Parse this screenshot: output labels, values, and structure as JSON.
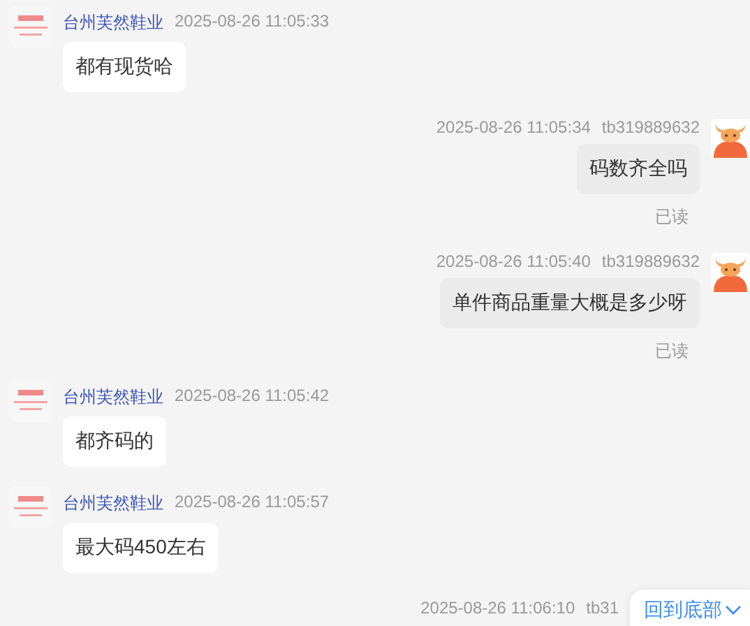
{
  "messages": [
    {
      "kind": "incoming",
      "sender": "台州芙然鞋业",
      "time": "2025-08-26 11:05:33",
      "text": "都有现货哈"
    },
    {
      "kind": "outgoing",
      "sender": "tb319889632",
      "time": "2025-08-26 11:05:34",
      "text": "码数齐全吗",
      "status": "已读"
    },
    {
      "kind": "outgoing",
      "sender": "tb319889632",
      "time": "2025-08-26 11:05:40",
      "text": "单件商品重量大概是多少呀",
      "status": "已读"
    },
    {
      "kind": "incoming",
      "sender": "台州芙然鞋业",
      "time": "2025-08-26 11:05:42",
      "text": "都齐码的"
    },
    {
      "kind": "incoming",
      "sender": "台州芙然鞋业",
      "time": "2025-08-26 11:05:57",
      "text": "最大码450左右"
    },
    {
      "kind": "outgoing_cut",
      "sender": "tb31",
      "time": "2025-08-26 11:06:10"
    }
  ],
  "scroll_button": {
    "label": "回到底部"
  }
}
